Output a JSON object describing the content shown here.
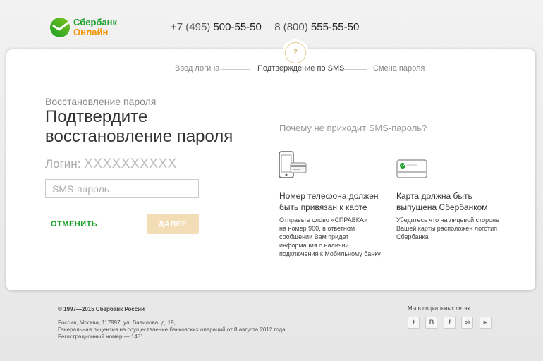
{
  "header": {
    "logo_line1": "Сбербанк",
    "logo_line2": "Онлайн",
    "phone1_code": "+7 (495)",
    "phone1_num": "500-55-50",
    "phone2_code": "8 (800)",
    "phone2_num": "555-55-50"
  },
  "steps": {
    "current_number": "2",
    "items": [
      "Ввод логина",
      "Подтверждение по SMS",
      "Смена пароля"
    ]
  },
  "form": {
    "subtitle": "Восстановление пароля",
    "title": "Подтвердите восстановление пароля",
    "login_label": "Логин:",
    "login_value": "XXXXXXXXXX",
    "sms_placeholder": "SMS-пароль",
    "cancel_label": "ОТМЕНИТЬ",
    "next_label": "ДАЛЕЕ"
  },
  "help": {
    "heading": "Почему не приходит SMS-пароль?",
    "items": [
      {
        "icon": "phone-card-icon",
        "title_line1": "Номер телефона должен",
        "title_line2": "быть привязан к карте",
        "desc": [
          "Отправьте слово «СПРАВКА»",
          "на номер 900, в ответном",
          "сообщении Вам придет",
          "информация о наличии",
          "подключения к Мобильному банку"
        ]
      },
      {
        "icon": "sberbank-card-icon",
        "title_line1": "Карта должна быть",
        "title_line2": "выпущена Сбербанком",
        "desc": [
          "Убедитесь что на лицевой стороне",
          "Вашей карты расположен логотип",
          "Сбербанка"
        ]
      }
    ]
  },
  "footer": {
    "copyright": "© 1997—2015 Сбербанк России",
    "address": [
      "Россия, Москва, 117997, ул. Вавилова, д. 19,",
      "Генеральная лицензия на осуществление банковских операций от 8 августа 2012 года",
      "Регистрационный номер — 1481"
    ],
    "social_label": "Мы в социальных сетях",
    "social": [
      {
        "name": "twitter-icon",
        "glyph": "t"
      },
      {
        "name": "vk-icon",
        "glyph": "B"
      },
      {
        "name": "facebook-icon",
        "glyph": "f"
      },
      {
        "name": "odnoklassniki-icon",
        "glyph": "ok"
      },
      {
        "name": "youtube-icon",
        "glyph": "▶"
      }
    ]
  },
  "colors": {
    "brand_green": "#1a9f29",
    "brand_orange": "#f29400",
    "button_disabled": "#f3ddb6"
  }
}
